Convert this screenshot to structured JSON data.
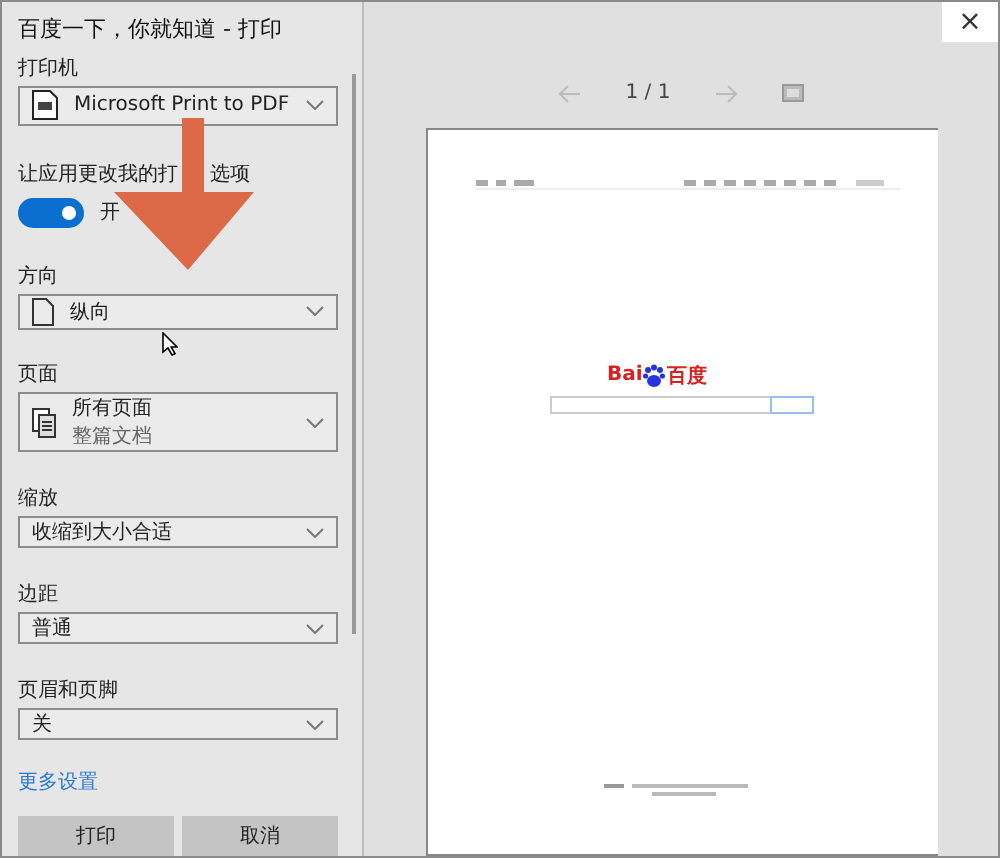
{
  "window": {
    "title": "百度一下，你就知道 - 打印",
    "close": "×"
  },
  "printer": {
    "label": "打印机",
    "value": "Microsoft Print to PDF"
  },
  "app_options": {
    "label_before": "让应用更改我的打",
    "label_after": "选项",
    "on": true,
    "state_text": "开"
  },
  "settings": [
    {
      "label": "方向",
      "kind": "portrait",
      "value": "纵向"
    },
    {
      "label": "页面",
      "kind": "pages",
      "value": "所有页面",
      "sub": "整篇文档"
    },
    {
      "label": "缩放",
      "kind": "plain",
      "value": "收缩到大小合适"
    },
    {
      "label": "边距",
      "kind": "plain",
      "value": "普通"
    },
    {
      "label": "页眉和页脚",
      "kind": "plain",
      "value": "关"
    }
  ],
  "more_settings": "更多设置",
  "buttons": [
    {
      "label": "打印"
    },
    {
      "label": "取消"
    }
  ],
  "preview": {
    "page_indicator": "1 / 1",
    "logo_left": "Bai",
    "logo_right": "百度"
  }
}
